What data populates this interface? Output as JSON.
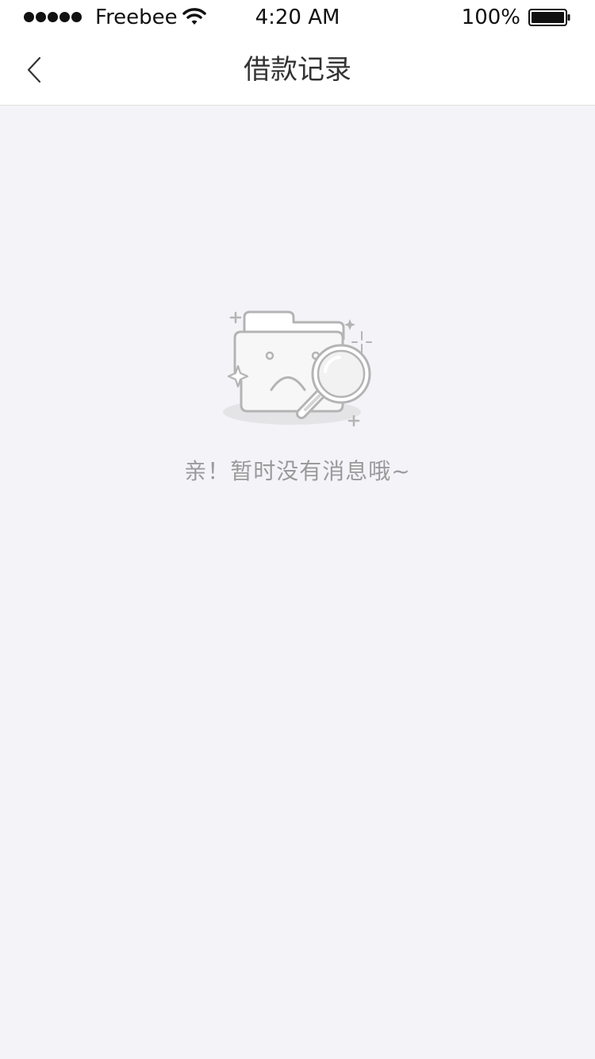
{
  "status_bar": {
    "carrier": "Freebee",
    "time": "4:20 AM",
    "battery": "100%"
  },
  "nav": {
    "title": "借款记录"
  },
  "empty_state": {
    "message": "亲！暂时没有消息哦~",
    "icon": "empty-folder-magnifier-icon"
  },
  "colors": {
    "background": "#f4f3f8",
    "nav_background": "#ffffff",
    "title": "#333333",
    "empty_text": "#9a9a9a",
    "illustration_stroke": "#b4b4b4"
  }
}
